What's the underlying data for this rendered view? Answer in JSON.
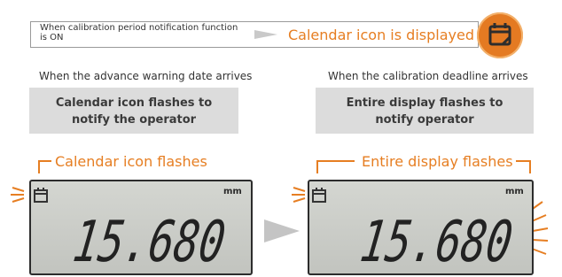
{
  "top": {
    "note": "When calibration period notification function is ON",
    "result": "Calendar icon is displayed",
    "icon": "calendar-icon"
  },
  "left": {
    "caption": "When the advance warning date arrives",
    "box_line1": "Calendar icon flashes to",
    "box_line2": "notify the operator",
    "label": "Calendar icon flashes",
    "reading": "15.680",
    "unit": "mm"
  },
  "right": {
    "caption": "When the calibration deadline arrives",
    "box_line1": "Entire display flashes to",
    "box_line2": "notify operator",
    "label": "Entire display flashes",
    "reading": "15.680",
    "unit": "mm"
  },
  "colors": {
    "accent": "#e67e22",
    "box_gray": "#dcdcdc",
    "lcd_bg": "#c8cac5"
  }
}
